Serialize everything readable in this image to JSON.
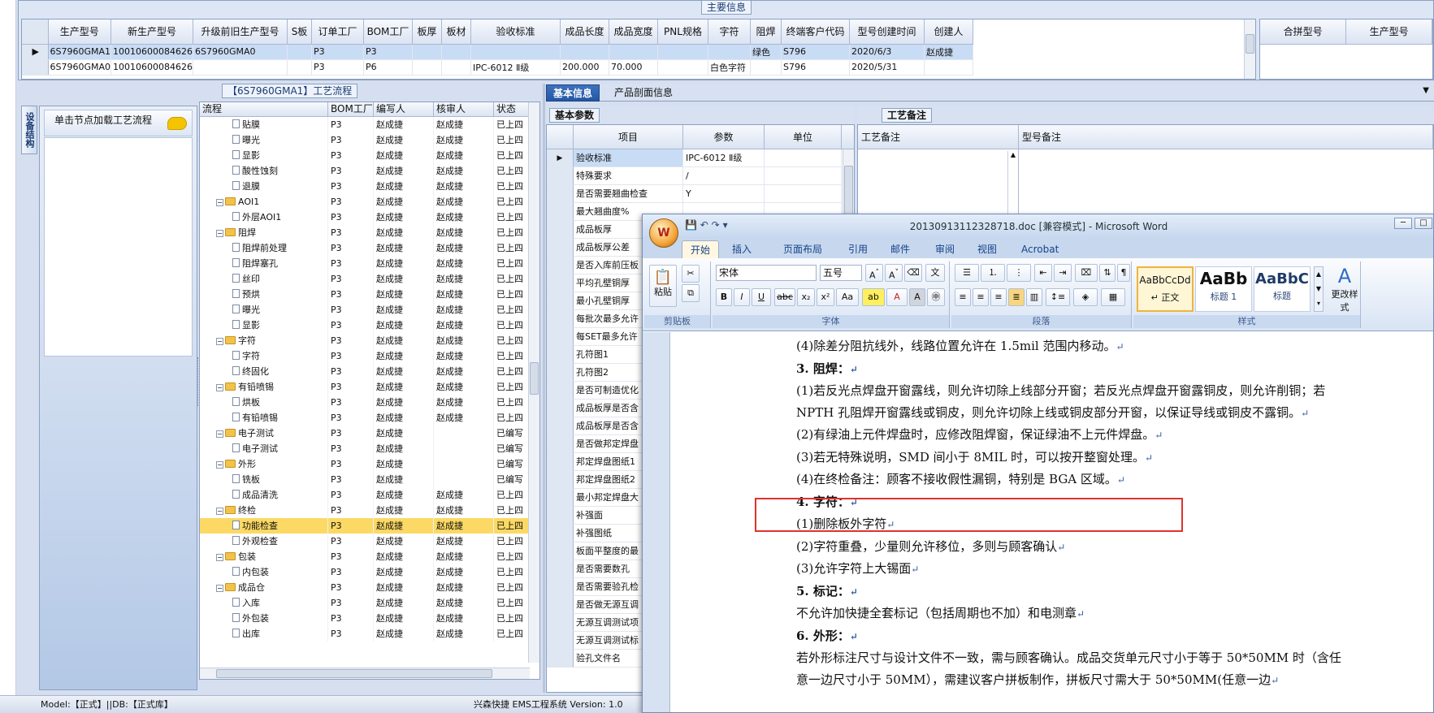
{
  "main_info": {
    "caption": "主要信息",
    "columns": [
      "生产型号",
      "新生产型号",
      "升级前旧生产型号",
      "S板",
      "订单工厂",
      "BOM工厂",
      "板厚",
      "板材",
      "验收标准",
      "成品长度",
      "成品宽度",
      "PNL规格",
      "字符",
      "阻焊",
      "终端客户代码",
      "型号创建时间",
      "创建人"
    ],
    "rows": [
      [
        "6S7960GMA1",
        "10010600084626",
        "6S7960GMA0",
        "",
        "P3",
        "P3",
        "",
        "",
        "",
        "",
        "",
        "",
        "",
        "绿色",
        "S796",
        "2020/6/3",
        "赵成捷"
      ],
      [
        "6S7960GMA0",
        "10010600084626",
        "",
        "",
        "P3",
        "P6",
        "",
        "",
        "IPC-6012 Ⅱ级",
        "200.000",
        "70.000",
        "",
        "白色字符",
        "",
        "S796",
        "2020/5/31",
        ""
      ]
    ],
    "merge_columns": [
      "合拼型号",
      "生产型号"
    ]
  },
  "side_tab": "设备结构",
  "node_hint": "单击节点加载工艺流程",
  "process_caption": "【6S7960GMA1】工艺流程",
  "process_columns": [
    "流程",
    "BOM工厂",
    "编写人",
    "核审人",
    "状态"
  ],
  "process_rows": [
    {
      "name": "贴膜",
      "level": 2,
      "bom": "P3",
      "writer": "赵成捷",
      "reviewer": "赵成捷",
      "status": "已上四"
    },
    {
      "name": "曝光",
      "level": 2,
      "bom": "P3",
      "writer": "赵成捷",
      "reviewer": "赵成捷",
      "status": "已上四"
    },
    {
      "name": "显影",
      "level": 2,
      "bom": "P3",
      "writer": "赵成捷",
      "reviewer": "赵成捷",
      "status": "已上四"
    },
    {
      "name": "酸性蚀刻",
      "level": 2,
      "bom": "P3",
      "writer": "赵成捷",
      "reviewer": "赵成捷",
      "status": "已上四"
    },
    {
      "name": "退膜",
      "level": 2,
      "bom": "P3",
      "writer": "赵成捷",
      "reviewer": "赵成捷",
      "status": "已上四"
    },
    {
      "name": "AOI1",
      "level": 1,
      "bom": "P3",
      "writer": "赵成捷",
      "reviewer": "赵成捷",
      "status": "已上四"
    },
    {
      "name": "外层AOI1",
      "level": 2,
      "bom": "P3",
      "writer": "赵成捷",
      "reviewer": "赵成捷",
      "status": "已上四"
    },
    {
      "name": "阻焊",
      "level": 1,
      "bom": "P3",
      "writer": "赵成捷",
      "reviewer": "赵成捷",
      "status": "已上四"
    },
    {
      "name": "阻焊前处理",
      "level": 2,
      "bom": "P3",
      "writer": "赵成捷",
      "reviewer": "赵成捷",
      "status": "已上四"
    },
    {
      "name": "阻焊塞孔",
      "level": 2,
      "bom": "P3",
      "writer": "赵成捷",
      "reviewer": "赵成捷",
      "status": "已上四"
    },
    {
      "name": "丝印",
      "level": 2,
      "bom": "P3",
      "writer": "赵成捷",
      "reviewer": "赵成捷",
      "status": "已上四"
    },
    {
      "name": "预烘",
      "level": 2,
      "bom": "P3",
      "writer": "赵成捷",
      "reviewer": "赵成捷",
      "status": "已上四"
    },
    {
      "name": "曝光",
      "level": 2,
      "bom": "P3",
      "writer": "赵成捷",
      "reviewer": "赵成捷",
      "status": "已上四"
    },
    {
      "name": "显影",
      "level": 2,
      "bom": "P3",
      "writer": "赵成捷",
      "reviewer": "赵成捷",
      "status": "已上四"
    },
    {
      "name": "字符",
      "level": 1,
      "bom": "P3",
      "writer": "赵成捷",
      "reviewer": "赵成捷",
      "status": "已上四"
    },
    {
      "name": "字符",
      "level": 2,
      "bom": "P3",
      "writer": "赵成捷",
      "reviewer": "赵成捷",
      "status": "已上四"
    },
    {
      "name": "终固化",
      "level": 2,
      "bom": "P3",
      "writer": "赵成捷",
      "reviewer": "赵成捷",
      "status": "已上四"
    },
    {
      "name": "有铅喷锡",
      "level": 1,
      "bom": "P3",
      "writer": "赵成捷",
      "reviewer": "赵成捷",
      "status": "已上四"
    },
    {
      "name": "烘板",
      "level": 2,
      "bom": "P3",
      "writer": "赵成捷",
      "reviewer": "赵成捷",
      "status": "已上四"
    },
    {
      "name": "有铅喷锡",
      "level": 2,
      "bom": "P3",
      "writer": "赵成捷",
      "reviewer": "赵成捷",
      "status": "已上四"
    },
    {
      "name": "电子测试",
      "level": 1,
      "bom": "P3",
      "writer": "赵成捷",
      "reviewer": "",
      "status": "已编写"
    },
    {
      "name": "电子测试",
      "level": 2,
      "bom": "P3",
      "writer": "赵成捷",
      "reviewer": "",
      "status": "已编写"
    },
    {
      "name": "外形",
      "level": 1,
      "bom": "P3",
      "writer": "赵成捷",
      "reviewer": "",
      "status": "已编写"
    },
    {
      "name": "铣板",
      "level": 2,
      "bom": "P3",
      "writer": "赵成捷",
      "reviewer": "",
      "status": "已编写"
    },
    {
      "name": "成品清洗",
      "level": 2,
      "bom": "P3",
      "writer": "赵成捷",
      "reviewer": "赵成捷",
      "status": "已上四"
    },
    {
      "name": "终检",
      "level": 1,
      "bom": "P3",
      "writer": "赵成捷",
      "reviewer": "赵成捷",
      "status": "已上四"
    },
    {
      "name": "功能检查",
      "level": 2,
      "bom": "P3",
      "writer": "赵成捷",
      "reviewer": "赵成捷",
      "status": "已上四",
      "highlight": true
    },
    {
      "name": "外观检查",
      "level": 2,
      "bom": "P3",
      "writer": "赵成捷",
      "reviewer": "赵成捷",
      "status": "已上四"
    },
    {
      "name": "包装",
      "level": 1,
      "bom": "P3",
      "writer": "赵成捷",
      "reviewer": "赵成捷",
      "status": "已上四"
    },
    {
      "name": "内包装",
      "level": 2,
      "bom": "P3",
      "writer": "赵成捷",
      "reviewer": "赵成捷",
      "status": "已上四"
    },
    {
      "name": "成品仓",
      "level": 1,
      "bom": "P3",
      "writer": "赵成捷",
      "reviewer": "赵成捷",
      "status": "已上四"
    },
    {
      "name": "入库",
      "level": 2,
      "bom": "P3",
      "writer": "赵成捷",
      "reviewer": "赵成捷",
      "status": "已上四"
    },
    {
      "name": "外包装",
      "level": 2,
      "bom": "P3",
      "writer": "赵成捷",
      "reviewer": "赵成捷",
      "status": "已上四"
    },
    {
      "name": "出库",
      "level": 2,
      "bom": "P3",
      "writer": "赵成捷",
      "reviewer": "赵成捷",
      "status": "已上四"
    }
  ],
  "basic_tabs": [
    "基本信息",
    "产品剖面信息"
  ],
  "params_caption": "基本参数",
  "params_columns": [
    "项目",
    "参数",
    "单位"
  ],
  "params_rows": [
    {
      "item": "验收标准",
      "value": "IPC-6012 Ⅱ级",
      "unit": ""
    },
    {
      "item": "特殊要求",
      "value": "/",
      "unit": ""
    },
    {
      "item": "是否需要翘曲检查",
      "value": "Y",
      "unit": ""
    },
    {
      "item": "最大翘曲度%",
      "value": "",
      "unit": ""
    },
    {
      "item": "成品板厚",
      "value": "",
      "unit": ""
    },
    {
      "item": "成品板厚公差",
      "value": "",
      "unit": ""
    },
    {
      "item": "是否入库前压板",
      "value": "",
      "unit": ""
    },
    {
      "item": "平均孔壁铜厚",
      "value": "",
      "unit": ""
    },
    {
      "item": "最小孔壁铜厚",
      "value": "",
      "unit": ""
    },
    {
      "item": "每批次最多允许",
      "value": "",
      "unit": ""
    },
    {
      "item": "每SET最多允许",
      "value": "",
      "unit": ""
    },
    {
      "item": "孔符图1",
      "value": "",
      "unit": ""
    },
    {
      "item": "孔符图2",
      "value": "",
      "unit": ""
    },
    {
      "item": "是否可制造优化",
      "value": "",
      "unit": ""
    },
    {
      "item": "成品板厚是否含",
      "value": "",
      "unit": ""
    },
    {
      "item": "成品板厚是否含",
      "value": "",
      "unit": ""
    },
    {
      "item": "是否做邦定焊盘",
      "value": "",
      "unit": ""
    },
    {
      "item": "邦定焊盘图纸1",
      "value": "",
      "unit": ""
    },
    {
      "item": "邦定焊盘图纸2",
      "value": "",
      "unit": ""
    },
    {
      "item": "最小邦定焊盘大",
      "value": "",
      "unit": ""
    },
    {
      "item": "补强面",
      "value": "",
      "unit": ""
    },
    {
      "item": "补强图纸",
      "value": "",
      "unit": ""
    },
    {
      "item": "板面平整度的最",
      "value": "",
      "unit": ""
    },
    {
      "item": "是否需要数孔",
      "value": "",
      "unit": ""
    },
    {
      "item": "是否需要验孔检",
      "value": "",
      "unit": ""
    },
    {
      "item": "是否做无源互调",
      "value": "",
      "unit": ""
    },
    {
      "item": "无源互调测试项",
      "value": "",
      "unit": ""
    },
    {
      "item": "无源互调测试标",
      "value": "",
      "unit": ""
    },
    {
      "item": "验孔文件名",
      "value": "",
      "unit": ""
    }
  ],
  "remark_caption": "工艺备注",
  "remark_columns": [
    "工艺备注",
    "型号备注"
  ],
  "status_bar": {
    "left": "Model:【正式】||DB:【正式库】",
    "right": "兴森快捷 EMS工程系统 Version: 1.0"
  },
  "word": {
    "title": "20130913112328718.doc [兼容模式] - Microsoft Word",
    "tabs": [
      "开始",
      "插入",
      "页面布局",
      "引用",
      "邮件",
      "审阅",
      "视图",
      "Acrobat"
    ],
    "font_name": "宋体",
    "font_size": "五号",
    "paste_label": "粘贴",
    "groups": [
      "剪贴板",
      "字体",
      "段落",
      "样式"
    ],
    "styles": [
      {
        "sample": "AaBbCcDd",
        "name": "↵ 正文"
      },
      {
        "sample": "AaBb",
        "name": "标题 1"
      },
      {
        "sample": "AaBbC",
        "name": "标题"
      }
    ],
    "change_styles_label": "更改样式",
    "paragraphs": [
      {
        "text": "(4)除差分阻抗线外，线路位置允许在 1.5mil 范围内移动。",
        "bold": false
      },
      {
        "text": "3. 阻焊：",
        "bold": true
      },
      {
        "text": "(1)若反光点焊盘开窗露线，则允许切除上线部分开窗；若反光点焊盘开窗露铜皮，则允许削铜；若 NPTH 孔阻焊开窗露线或铜皮，则允许切除上线或铜皮部分开窗，以保证导线或铜皮不露铜。",
        "bold": false,
        "wrap": true
      },
      {
        "text": "(2)有绿油上元件焊盘时，应修改阻焊窗，保证绿油不上元件焊盘。",
        "bold": false
      },
      {
        "text": "(3)若无特殊说明，SMD 间小于 8MIL 时，可以按开整窗处理。",
        "bold": false
      },
      {
        "text": "(4)在终检备注：顾客不接收假性漏铜，特别是 BGA 区域。",
        "bold": false
      },
      {
        "text": "4. 字符：",
        "bold": true
      },
      {
        "text": "(1)删除板外字符",
        "bold": false
      },
      {
        "text": "(2)字符重叠，少量则允许移位，多则与顾客确认",
        "bold": false
      },
      {
        "text": "(3)允许字符上大锡面",
        "bold": false
      },
      {
        "text": "5. 标记：",
        "bold": true
      },
      {
        "text": "不允许加快捷全套标记（包括周期也不加）和电测章",
        "bold": false
      },
      {
        "text": "6. 外形：",
        "bold": true
      },
      {
        "text": "若外形标注尺寸与设计文件不一致，需与顾客确认。成品交货单元尺寸小于等于 50*50MM 时（含任意一边尺寸小于 50MM），需建议客户拼板制作，拼板尺寸需大于 50*50MM(任意一边",
        "bold": false,
        "wrap": true
      }
    ]
  }
}
